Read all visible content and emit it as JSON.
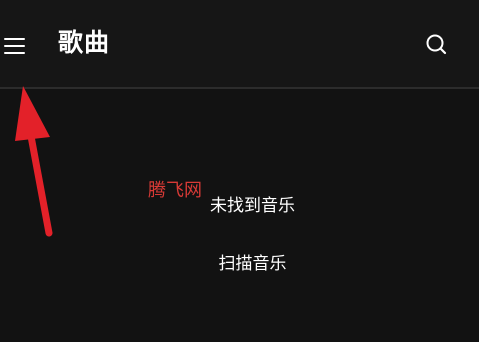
{
  "header": {
    "title": "歌曲",
    "menu_icon": "hamburger-menu-icon",
    "search_icon": "search-icon"
  },
  "main": {
    "empty_message": "未找到音乐",
    "scan_button_label": "扫描音乐"
  },
  "watermark": {
    "text": "腾飞网"
  },
  "annotation": {
    "icon": "red-arrow-pointing-at-menu",
    "color": "#e32129"
  },
  "colors": {
    "background": "#121212",
    "topbar": "#161616",
    "text": "#ffffff"
  }
}
